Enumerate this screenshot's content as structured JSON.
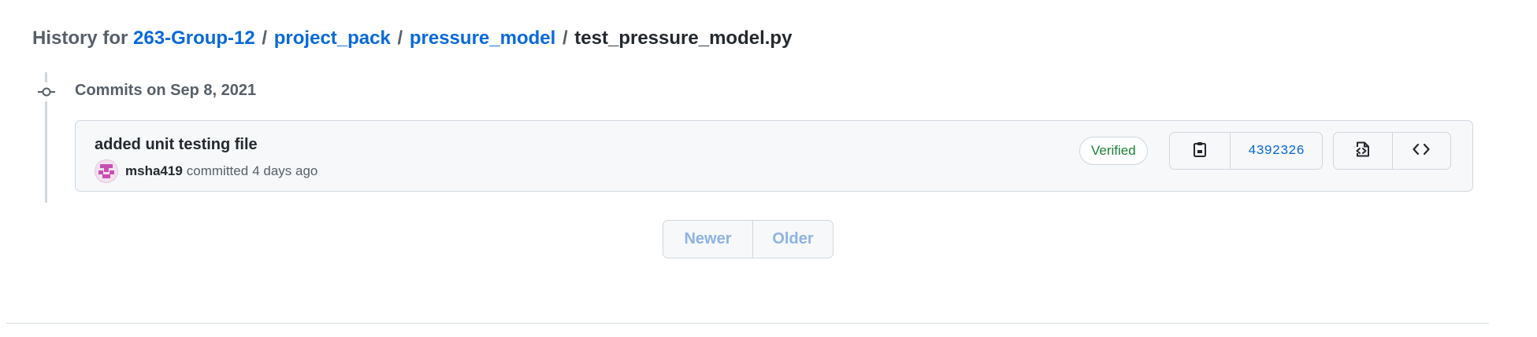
{
  "header": {
    "prefix": "History for",
    "repo": "263-Group-12",
    "separator": "/",
    "path": [
      "project_pack",
      "pressure_model"
    ],
    "file": "test_pressure_model.py"
  },
  "timeline": {
    "date_label": "Commits on Sep 8, 2021"
  },
  "commit": {
    "title": "added unit testing file",
    "author": "msha419",
    "action": "committed",
    "relative_time": "4 days ago",
    "verified_label": "Verified",
    "sha": "4392326",
    "icons": {
      "copy": "clipboard-icon",
      "browse_files": "file-code-icon",
      "browse_repo": "code-icon",
      "commit_dot": "git-commit-icon"
    }
  },
  "pagination": {
    "newer_label": "Newer",
    "older_label": "Older"
  },
  "colors": {
    "link": "#0969da",
    "verified": "#1a7f37",
    "border": "#d0d7de",
    "box_bg": "#f6f8fa",
    "disabled_link": "#8fb3e6"
  }
}
